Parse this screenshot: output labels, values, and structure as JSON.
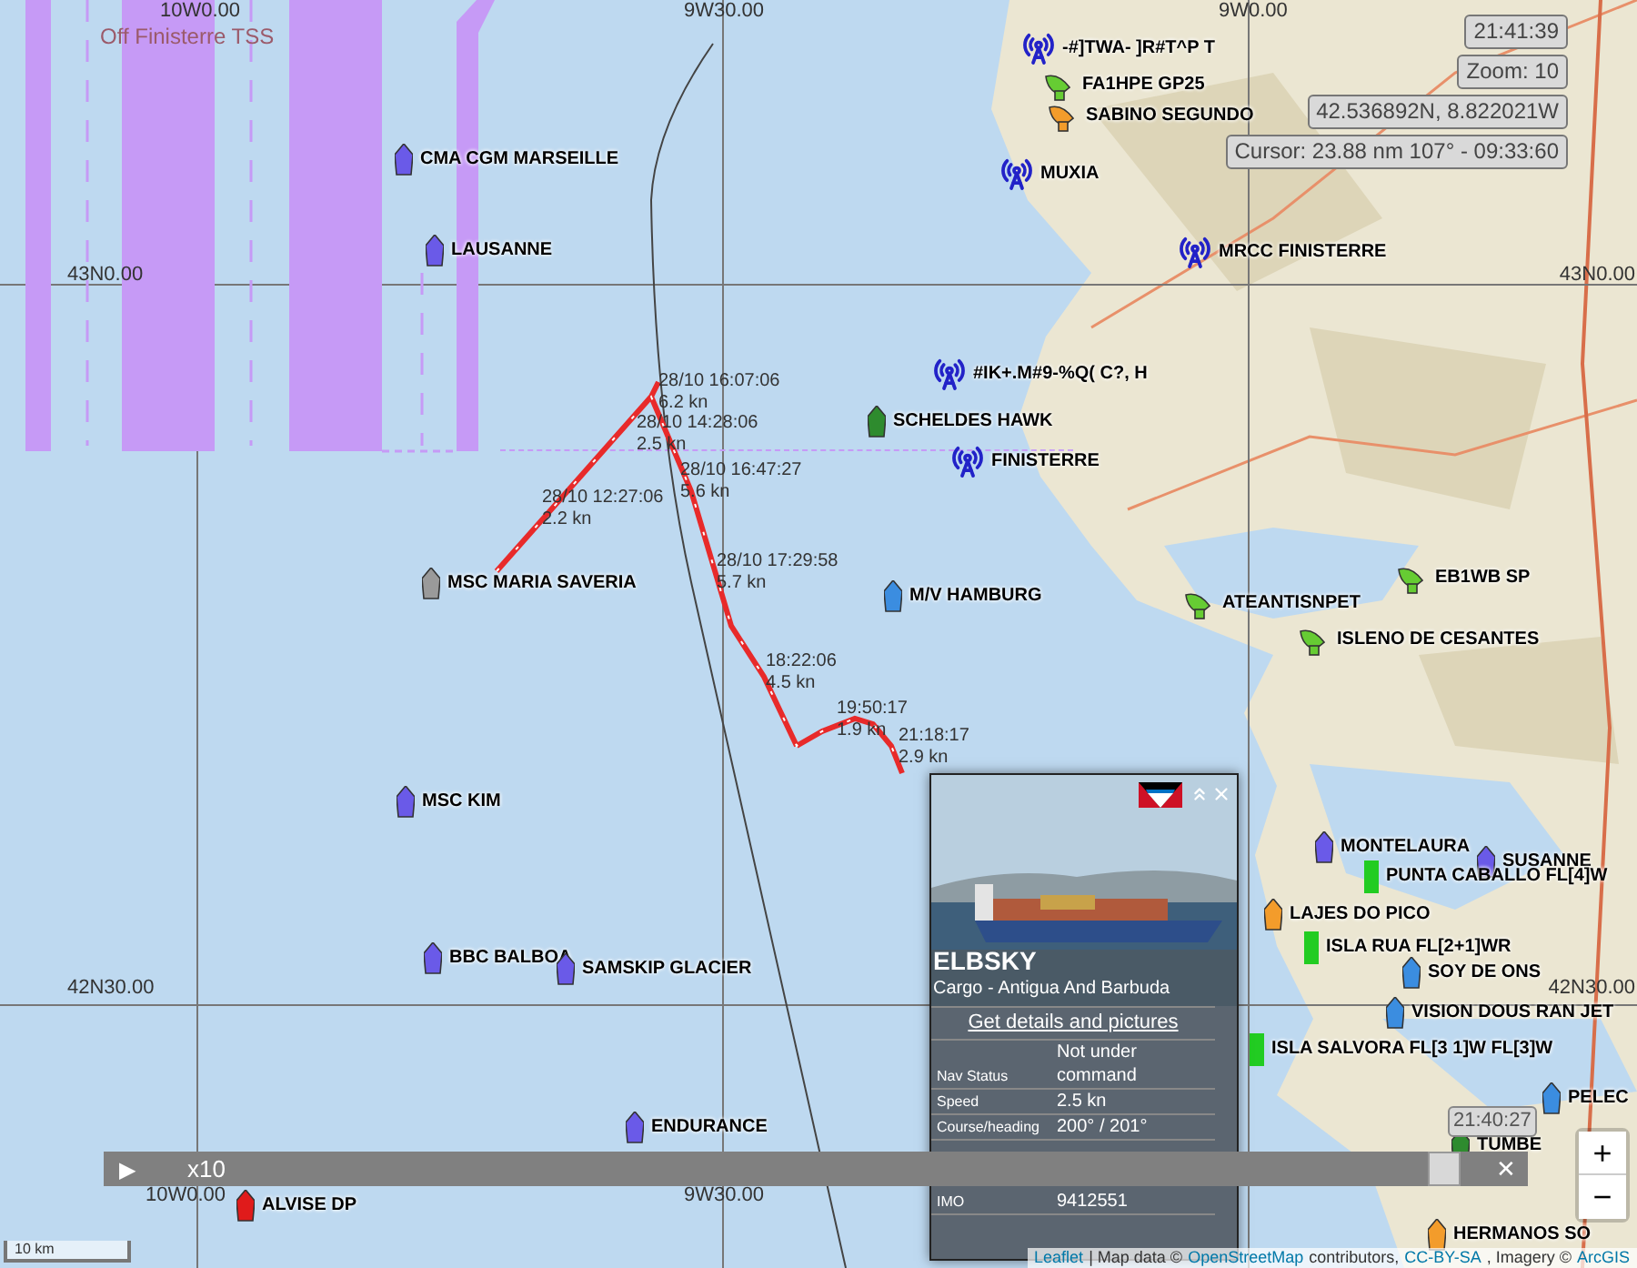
{
  "grid_labels": [
    "10W0.00",
    "9W30.00",
    "9W0.00",
    "43N0.00",
    "43N0.00",
    "42N30.00",
    "42N30.00",
    "10W0.00",
    "9W30.00"
  ],
  "tss_label": "Off Finisterre TSS",
  "vessels": [
    {
      "name": "CMA CGM MARSEILLE",
      "kind": "ship",
      "color": "#6a5ae8"
    },
    {
      "name": "LAUSANNE",
      "kind": "ship",
      "color": "#6a5ae8"
    },
    {
      "name": "MSC MARIA SAVERIA",
      "kind": "ship",
      "color": "#9a9a9a"
    },
    {
      "name": "M/V HAMBURG",
      "kind": "ship",
      "color": "#3b8de0"
    },
    {
      "name": "MSC KIM",
      "kind": "ship",
      "color": "#6a5ae8"
    },
    {
      "name": "BBC BALBOA",
      "kind": "ship",
      "color": "#6a5ae8"
    },
    {
      "name": "SAMSKIP GLACIER",
      "kind": "ship",
      "color": "#6a5ae8"
    },
    {
      "name": "ENDURANCE",
      "kind": "ship",
      "color": "#6a5ae8"
    },
    {
      "name": "ALVISE DP",
      "kind": "ship",
      "color": "#e01b1b"
    },
    {
      "name": "SCHELDES HAWK",
      "kind": "ship",
      "color": "#2e8b2e"
    },
    {
      "name": "-#]TWA- ]R#T^P T",
      "kind": "tower",
      "color": "#2222c8"
    },
    {
      "name": "FA1HPE GP25",
      "kind": "station",
      "color": "#66cc33"
    },
    {
      "name": "SABINO SEGUNDO",
      "kind": "station",
      "color": "#f39c2b"
    },
    {
      "name": "MUXIA",
      "kind": "tower",
      "color": "#2222c8"
    },
    {
      "name": "MRCC FINISTERRE",
      "kind": "tower",
      "color": "#2222c8"
    },
    {
      "name": "#IK+.M#9-%Q( C?, H",
      "kind": "tower",
      "color": "#2222c8"
    },
    {
      "name": "FINISTERRE",
      "kind": "tower",
      "color": "#2222c8"
    },
    {
      "name": "ATEANTISNPET",
      "kind": "station",
      "color": "#66cc33"
    },
    {
      "name": "EB1WB SP",
      "kind": "station",
      "color": "#66cc33"
    },
    {
      "name": "ISLENO DE CESANTES",
      "kind": "station",
      "color": "#66cc33"
    },
    {
      "name": "MONTELAURA",
      "kind": "ship",
      "color": "#6a5ae8"
    },
    {
      "name": "SUSANNE",
      "kind": "ship",
      "color": "#6a5ae8"
    },
    {
      "name": "LAJES DO PICO",
      "kind": "ship",
      "color": "#f39c2b"
    },
    {
      "name": "PUNTA CABALLO FL[4]W",
      "kind": "light",
      "color": "#22cc22"
    },
    {
      "name": "ISLA RUA FL[2+1]WR",
      "kind": "light",
      "color": "#22cc22"
    },
    {
      "name": "SOY DE ONS",
      "kind": "ship",
      "color": "#3b8de0"
    },
    {
      "name": "VISION DOUS RAN JET",
      "kind": "ship",
      "color": "#3b8de0"
    },
    {
      "name": "ISLA SALVORA FL[3 1]W FL[3]W",
      "kind": "light",
      "color": "#22cc22"
    },
    {
      "name": "PELEC",
      "kind": "ship",
      "color": "#3b8de0"
    },
    {
      "name": "TUMBE",
      "kind": "ship",
      "color": "#2e8b2e"
    },
    {
      "name": "HERMANOS SO",
      "kind": "ship",
      "color": "#f39c2b"
    }
  ],
  "track_points": [
    {
      "time": "28/10 16:07:06",
      "speed": "6.2 kn"
    },
    {
      "time": "28/10 14:28:06",
      "speed": "2.5 kn"
    },
    {
      "time": "28/10 16:47:27",
      "speed": "5.6 kn"
    },
    {
      "time": "28/10 12:27:06",
      "speed": "2.2 kn"
    },
    {
      "time": "28/10 17:29:58",
      "speed": "5.7 kn"
    },
    {
      "time": "18:22:06",
      "speed": "4.5 kn"
    },
    {
      "time": "19:50:17",
      "speed": "1.9 kn"
    },
    {
      "time": "21:18:17",
      "speed": "2.9 kn"
    }
  ],
  "info_boxes": [
    "21:41:39",
    "Zoom: 10",
    "42.536892N, 8.822021W",
    "Cursor: 23.88 nm 107° - 09:33:60"
  ],
  "popup": {
    "name": "ELBSKY",
    "subtitle": "Cargo - Antigua And Barbuda",
    "link": "Get details and pictures",
    "rows": [
      {
        "label": "Nav Status",
        "value": "Not under command"
      },
      {
        "label": "Speed",
        "value": "2.5 kn"
      },
      {
        "label": "Course/heading",
        "value": "200° / 201°"
      },
      {
        "label": "IMO",
        "value": "9412551"
      }
    ]
  },
  "playback": {
    "play": "▶",
    "speed": "x10",
    "time": "21:40:27",
    "level": 0.98,
    "close": "✕"
  },
  "zoom": {
    "in": "+",
    "out": "−"
  },
  "scale": "10 km",
  "attribution": [
    {
      "text": "Leaflet",
      "link": true
    },
    {
      "text": "| Map data ©",
      "link": false
    },
    {
      "text": "OpenStreetMap",
      "link": true
    },
    {
      "text": "contributors,",
      "link": false
    },
    {
      "text": "CC-BY-SA",
      "link": true
    },
    {
      "text": ", Imagery ©",
      "link": false
    },
    {
      "text": "ArcGIS",
      "link": true
    }
  ]
}
